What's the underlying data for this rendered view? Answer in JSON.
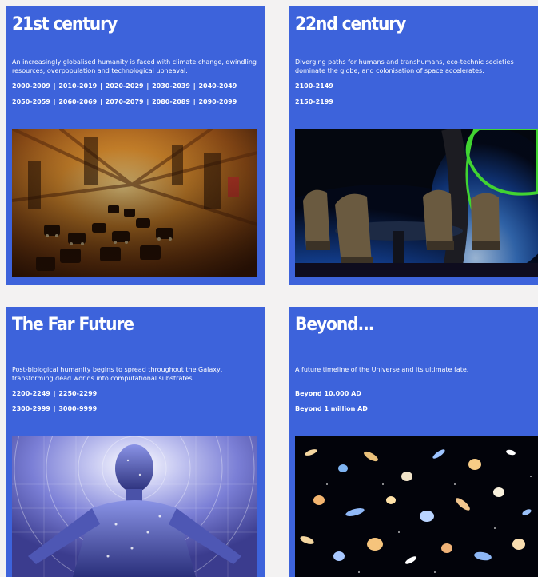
{
  "cards": [
    {
      "title": "21st century",
      "description": "An increasingly globalised humanity is faced with climate change, dwindling resources, overpopulation and technological upheaval.",
      "links_row1": [
        "2000-2009",
        "2010-2019",
        "2020-2029",
        "2030-2039",
        "2040-2049"
      ],
      "links_row2": [
        "2050-2059",
        "2060-2069",
        "2070-2079",
        "2080-2089",
        "2090-2099"
      ],
      "image_subject": "blurred-city-traffic"
    },
    {
      "title": "22nd century",
      "description": "Diverging paths for humans and transhumans, eco-technic societies dominate the globe, and colonisation of space accelerates.",
      "links_row1": [
        "2100-2149"
      ],
      "links_row2": [
        "2150-2199"
      ],
      "image_subject": "space-station-lounge-earth-view"
    },
    {
      "title": "The Far Future",
      "description": "Post-biological humanity begins to spread throughout the Galaxy, transforming dead worlds into computational substrates.",
      "links_row1": [
        "2200-2249",
        "2250-2299"
      ],
      "links_row2": [
        "2300-2999",
        "3000-9999"
      ],
      "image_subject": "glowing-digital-human"
    },
    {
      "title": "Beyond...",
      "description": "A future timeline of the Universe and its ultimate fate.",
      "links_row1": [
        "Beyond 10,000 AD"
      ],
      "links_row2": [
        "Beyond 1 million AD"
      ],
      "image_subject": "deep-field-galaxies"
    }
  ],
  "colors": {
    "card_background": "#3d63db",
    "page_background": "#f3f2f2",
    "text": "#ffffff"
  }
}
